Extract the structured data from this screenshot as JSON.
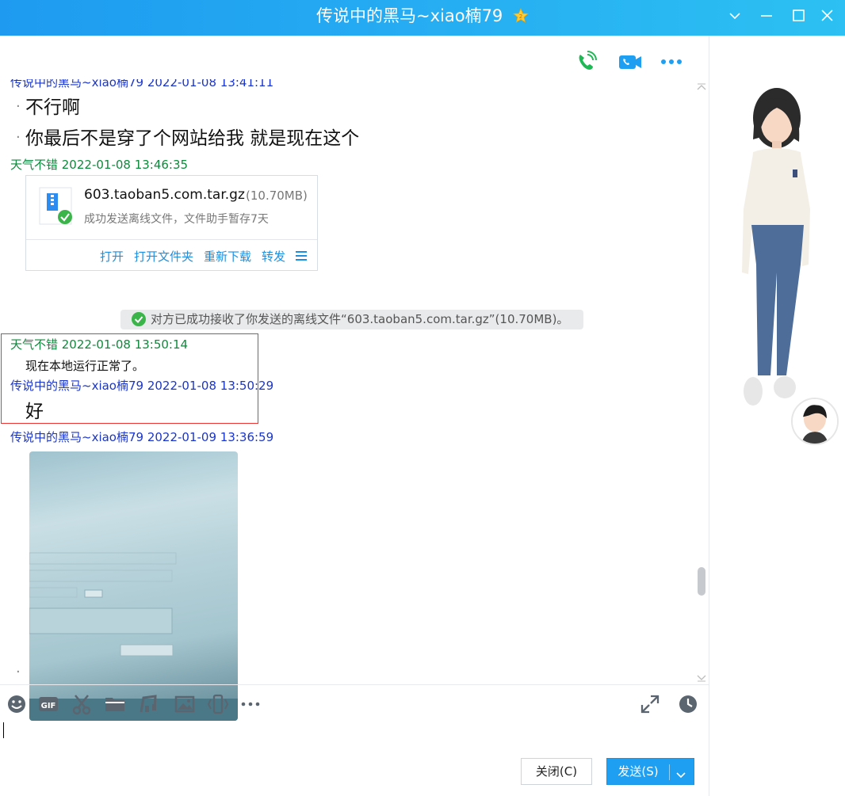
{
  "window": {
    "title": "传说中的黑马~xiao楠79",
    "badge_icon": "vip-star-icon",
    "accent_color": "#1e9bf0"
  },
  "header_actions": [
    {
      "name": "voice-call-icon",
      "color": "#1db954"
    },
    {
      "name": "video-call-icon",
      "color": "#1e9ff2"
    },
    {
      "name": "more-icon",
      "color": "#1e9ff2"
    }
  ],
  "messages": [
    {
      "sender": "传说中的黑马~xiao楠79",
      "time": "2022-01-08 13:41:11",
      "header": "传说中的黑马~xiao楠79 2022-01-08 13:41:11",
      "lines": [
        "不行啊",
        "你最后不是穿了个网站给我 就是现在这个"
      ]
    },
    {
      "sender": "天气不错",
      "header": "天气不错 2022-01-08 13:46:35",
      "file": {
        "name": "603.taoban5.com.tar.gz",
        "size": "(10.70MB)",
        "status": "成功发送离线文件，文件助手暂存7天",
        "actions": [
          "打开",
          "打开文件夹",
          "重新下载",
          "转发"
        ]
      }
    },
    {
      "notice": "对方已成功接收了你发送的离线文件“603.taoban5.com.tar.gz”(10.70MB)。"
    },
    {
      "sender": "天气不错",
      "header": "天气不错 2022-01-08 13:50:14",
      "lines": [
        "现在本地运行正常了。"
      ]
    },
    {
      "sender": "传说中的黑马~xiao楠79",
      "header": "传说中的黑马~xiao楠79 2022-01-08 13:50:29",
      "lines": [
        "好"
      ]
    },
    {
      "sender": "传说中的黑马~xiao楠79",
      "header": "传说中的黑马~xiao楠79 2022-01-09 13:36:59",
      "image": "photo-of-screen"
    }
  ],
  "toolbar": {
    "tools": [
      "emoji-icon",
      "gif-icon",
      "screenshot-scissors-icon",
      "folder-icon",
      "music-icon",
      "image-icon",
      "shake-icon",
      "more-tools-icon"
    ],
    "right_tools": [
      "fullscreen-icon",
      "history-clock-icon"
    ]
  },
  "buttons": {
    "close_label": "关闭(C)",
    "send_label": "发送(S)"
  }
}
